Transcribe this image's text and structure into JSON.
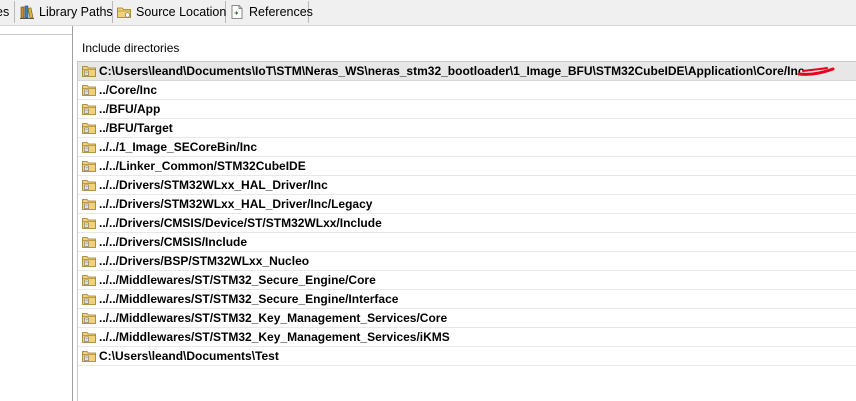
{
  "tabs": [
    {
      "label": "es",
      "icon": "generic-tab-icon"
    },
    {
      "label": "Library Paths",
      "icon": "library-books-icon"
    },
    {
      "label": "Source Location",
      "icon": "folder-icon"
    },
    {
      "label": "References",
      "icon": "references-page-icon"
    }
  ],
  "main": {
    "section_label": "Include directories",
    "include_directories": [
      "C:\\Users\\leand\\Documents\\IoT\\STM\\Neras_WS\\neras_stm32_bootloader\\1_Image_BFU\\STM32CubeIDE\\Application\\Core/Inc",
      "../Core/Inc",
      "../BFU/App",
      "../BFU/Target",
      "../../1_Image_SECoreBin/Inc",
      "../../Linker_Common/STM32CubeIDE",
      "../../Drivers/STM32WLxx_HAL_Driver/Inc",
      "../../Drivers/STM32WLxx_HAL_Driver/Inc/Legacy",
      "../../Drivers/CMSIS/Device/ST/STM32WLxx/Include",
      "../../Drivers/CMSIS/Include",
      "../../Drivers/BSP/STM32WLxx_Nucleo",
      "../../Middlewares/ST/STM32_Secure_Engine/Core",
      "../../Middlewares/ST/STM32_Secure_Engine/Interface",
      "../../Middlewares/ST/STM32_Key_Management_Services/Core",
      "../../Middlewares/ST/STM32_Key_Management_Services/iKMS",
      "C:\\Users\\leand\\Documents\\Test"
    ],
    "selected_index": 0,
    "row_icon": "include-folder-icon"
  },
  "colors": {
    "selected_row": "#e7e7e7",
    "annotation_red": "#e8001c",
    "folder_yellow": "#e6c25a"
  },
  "annotation": "red-arrow-mark"
}
